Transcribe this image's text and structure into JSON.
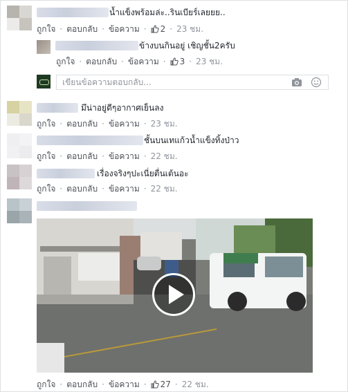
{
  "comments": [
    {
      "text": "น้ำแข็งพร้อมล่ะ..รินเบียร์เลยยย..",
      "like": "ถูกใจ",
      "reply": "ตอบกลับ",
      "message": "ข้อความ",
      "likes": "2",
      "time": "23 ชม."
    },
    {
      "text": "ข้างบนกินอยู่ เชิญชั้น2ครับ",
      "like": "ถูกใจ",
      "reply": "ตอบกลับ",
      "message": "ข้อความ",
      "likes": "3",
      "time": "23 ชม."
    },
    {
      "text": "มึน่าอยู่ดีๆอากาศเย็นลง",
      "like": "ถูกใจ",
      "reply": "ตอบกลับ",
      "message": "ข้อความ",
      "time": "23 ชม."
    },
    {
      "text": "ชั้นบนเทแก้วน้ำแข็งทิ้งป่าว",
      "like": "ถูกใจ",
      "reply": "ตอบกลับ",
      "message": "ข้อความ",
      "time": "22 ชม."
    },
    {
      "text": "เรื่องจริงๆปะเนี่ยตื่นเต้นอะ",
      "like": "ถูกใจ",
      "reply": "ตอบกลับ",
      "message": "ข้อความ",
      "time": "22 ชม."
    },
    {
      "like": "ถูกใจ",
      "reply": "ตอบกลับ",
      "message": "ข้อความ",
      "likes": "27",
      "time": "22 ชม."
    }
  ],
  "reply_box": {
    "placeholder": "เขียนข้อความตอบกลับ..."
  },
  "icons": {
    "like": "thumbs-up-icon",
    "camera": "camera-icon",
    "emoji": "smiley-icon",
    "play": "play-icon"
  },
  "colors": {
    "link": "#4b4f56",
    "meta": "#90949c",
    "text": "#1d2129",
    "border": "#dddfe2"
  }
}
